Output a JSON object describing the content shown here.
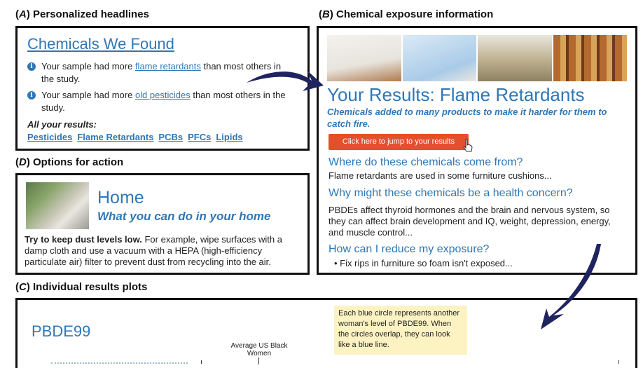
{
  "panelA": {
    "heading_letter": "A",
    "heading_text": "Personalized headlines",
    "title": "Chemicals We Found",
    "rows": [
      {
        "pre": "Your sample had more ",
        "link": "flame retardants",
        "post": " than most others in the study."
      },
      {
        "pre": "Your sample had more ",
        "link": "old pesticides",
        "post": " than most others in the study."
      }
    ],
    "all_label": "All your results:",
    "results": [
      "Pesticides",
      "Flame Retardants",
      "PCBs",
      "PFCs",
      "Lipids"
    ]
  },
  "panelB": {
    "heading_letter": "B",
    "heading_text": "Chemical exposure information",
    "image_colors": [
      "#e7e4dd",
      "#a9cbe8",
      "#bdb08f",
      "#b46a2e"
    ],
    "title": "Your Results: Flame Retardants",
    "subtitle": "Chemicals added to many products to make it harder for them to catch fire.",
    "button": "Click here to jump to your results",
    "q1": "Where do these chemicals come from?",
    "a1": "Flame retardants are used in some furniture cushions...",
    "q2": "Why might these chemicals be a health concern?",
    "a2": "PBDEs affect thyroid hormones and the brain and nervous system, so they can affect brain development and IQ, weight, depression, energy, and muscle control...",
    "q3": "How can I reduce my exposure?",
    "a3": "Fix rips in furniture so foam isn't exposed..."
  },
  "panelD": {
    "heading_letter": "D",
    "heading_text": "Options for action",
    "title": "Home",
    "subtitle": "What you can do in your home",
    "bold_text": "Try to keep dust levels low.",
    "text": " For example, wipe surfaces with a damp cloth and use a vacuum with a HEPA (high-efficiency particulate air) filter to prevent dust from recycling into the air."
  },
  "panelC": {
    "heading_letter": "C",
    "heading_text": "Individual results plots",
    "title": "PBDE99",
    "tooltip": "Each blue circle represents another woman's level of PBDE99. When the circles overlap, they can look like a blue line.",
    "avg_label": "Average US Black Women"
  },
  "colors": {
    "accent": "#2f77b6",
    "button": "#e4502c",
    "arrow": "#1f2460",
    "tooltip_bg": "#fdf3c2"
  }
}
